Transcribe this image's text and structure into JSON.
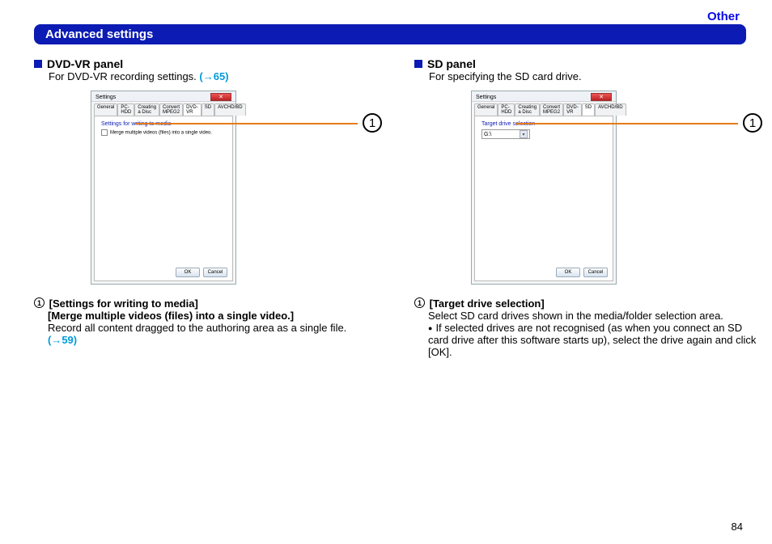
{
  "header_other": "Other",
  "section_title": "Advanced settings",
  "page_number": "84",
  "left": {
    "panel": "DVD-VR panel",
    "desc_pre": "For DVD-VR recording settings. ",
    "desc_link": "(→65)",
    "callout": "1",
    "shot": {
      "title": "Settings",
      "tabs": [
        "General",
        "PC-HDD",
        "Creating a Disc",
        "Convert MPEG2",
        "DVD-VR",
        "SD",
        "AVCHD/BD"
      ],
      "active_tab": "DVD-VR",
      "line1": "Settings for writing to media",
      "cb_label": "Merge multiple videos (files) into a single video.",
      "ok": "OK",
      "cancel": "Cancel"
    },
    "item_num": "1",
    "item_title1": "[Settings for writing to media]",
    "item_title2": "[Merge multiple videos (files) into a single video.]",
    "item_body": "Record all content dragged to the authoring area as a single file.",
    "item_link": "(→59)"
  },
  "right": {
    "panel": "SD panel",
    "desc": "For specifying the SD card drive.",
    "callout": "1",
    "shot": {
      "title": "Settings",
      "tabs": [
        "General",
        "PC-HDD",
        "Creating a Disc",
        "Convert MPEG2",
        "DVD-VR",
        "SD",
        "AVCHD/BD"
      ],
      "active_tab": "SD",
      "line1": "Target drive selection",
      "dd_value": "G:\\",
      "ok": "OK",
      "cancel": "Cancel"
    },
    "item_num": "1",
    "item_title1": "[Target drive selection]",
    "item_body": "Select SD card drives shown in the media/folder selection area.",
    "bullet": "If selected drives are not recognised (as when you connect an SD card drive after this software starts up), select the drive again and click [OK]."
  }
}
